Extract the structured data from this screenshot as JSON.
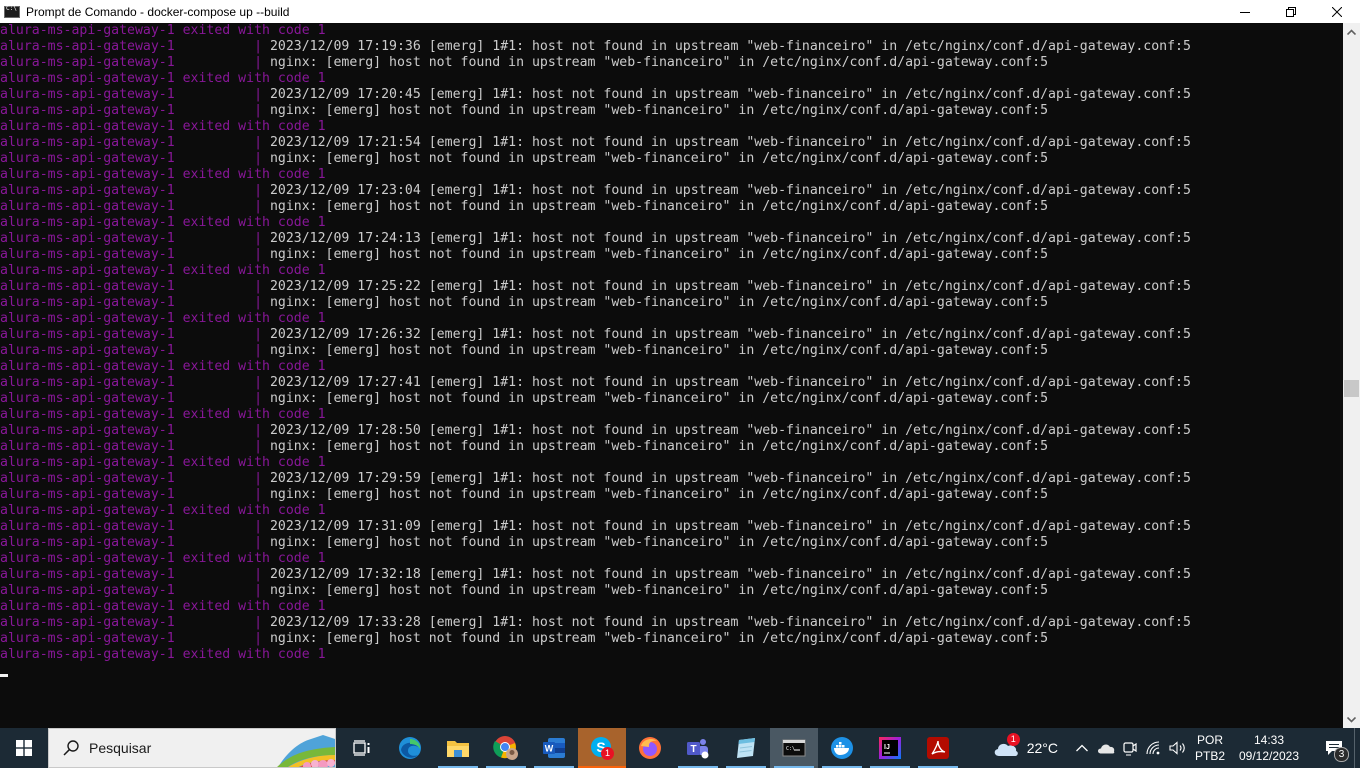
{
  "window": {
    "title": "Prompt de Comando - docker-compose  up --build",
    "controls": {
      "minimize": "minimize",
      "restore": "restore",
      "close": "close"
    }
  },
  "terminal": {
    "colors": {
      "service": "#881798",
      "message": "#cccccc",
      "background": "#0c0c0c"
    },
    "service_name": "alura-ms-api-gateway-1",
    "lines": [
      {
        "svc": "alura-ms-api-gateway-1 exited with code 1",
        "msg": ""
      },
      {
        "svc": "alura-ms-api-gateway-1          | ",
        "msg": "2023/12/09 17:19:36 [emerg] 1#1: host not found in upstream \"web-financeiro\" in /etc/nginx/conf.d/api-gateway.conf:5"
      },
      {
        "svc": "alura-ms-api-gateway-1          | ",
        "msg": "nginx: [emerg] host not found in upstream \"web-financeiro\" in /etc/nginx/conf.d/api-gateway.conf:5"
      },
      {
        "svc": "alura-ms-api-gateway-1 exited with code 1",
        "msg": ""
      },
      {
        "svc": "alura-ms-api-gateway-1          | ",
        "msg": "2023/12/09 17:20:45 [emerg] 1#1: host not found in upstream \"web-financeiro\" in /etc/nginx/conf.d/api-gateway.conf:5"
      },
      {
        "svc": "alura-ms-api-gateway-1          | ",
        "msg": "nginx: [emerg] host not found in upstream \"web-financeiro\" in /etc/nginx/conf.d/api-gateway.conf:5"
      },
      {
        "svc": "alura-ms-api-gateway-1 exited with code 1",
        "msg": ""
      },
      {
        "svc": "alura-ms-api-gateway-1          | ",
        "msg": "2023/12/09 17:21:54 [emerg] 1#1: host not found in upstream \"web-financeiro\" in /etc/nginx/conf.d/api-gateway.conf:5"
      },
      {
        "svc": "alura-ms-api-gateway-1          | ",
        "msg": "nginx: [emerg] host not found in upstream \"web-financeiro\" in /etc/nginx/conf.d/api-gateway.conf:5"
      },
      {
        "svc": "alura-ms-api-gateway-1 exited with code 1",
        "msg": ""
      },
      {
        "svc": "alura-ms-api-gateway-1          | ",
        "msg": "2023/12/09 17:23:04 [emerg] 1#1: host not found in upstream \"web-financeiro\" in /etc/nginx/conf.d/api-gateway.conf:5"
      },
      {
        "svc": "alura-ms-api-gateway-1          | ",
        "msg": "nginx: [emerg] host not found in upstream \"web-financeiro\" in /etc/nginx/conf.d/api-gateway.conf:5"
      },
      {
        "svc": "alura-ms-api-gateway-1 exited with code 1",
        "msg": ""
      },
      {
        "svc": "alura-ms-api-gateway-1          | ",
        "msg": "2023/12/09 17:24:13 [emerg] 1#1: host not found in upstream \"web-financeiro\" in /etc/nginx/conf.d/api-gateway.conf:5"
      },
      {
        "svc": "alura-ms-api-gateway-1          | ",
        "msg": "nginx: [emerg] host not found in upstream \"web-financeiro\" in /etc/nginx/conf.d/api-gateway.conf:5"
      },
      {
        "svc": "alura-ms-api-gateway-1 exited with code 1",
        "msg": ""
      },
      {
        "svc": "alura-ms-api-gateway-1          | ",
        "msg": "2023/12/09 17:25:22 [emerg] 1#1: host not found in upstream \"web-financeiro\" in /etc/nginx/conf.d/api-gateway.conf:5"
      },
      {
        "svc": "alura-ms-api-gateway-1          | ",
        "msg": "nginx: [emerg] host not found in upstream \"web-financeiro\" in /etc/nginx/conf.d/api-gateway.conf:5"
      },
      {
        "svc": "alura-ms-api-gateway-1 exited with code 1",
        "msg": ""
      },
      {
        "svc": "alura-ms-api-gateway-1          | ",
        "msg": "2023/12/09 17:26:32 [emerg] 1#1: host not found in upstream \"web-financeiro\" in /etc/nginx/conf.d/api-gateway.conf:5"
      },
      {
        "svc": "alura-ms-api-gateway-1          | ",
        "msg": "nginx: [emerg] host not found in upstream \"web-financeiro\" in /etc/nginx/conf.d/api-gateway.conf:5"
      },
      {
        "svc": "alura-ms-api-gateway-1 exited with code 1",
        "msg": ""
      },
      {
        "svc": "alura-ms-api-gateway-1          | ",
        "msg": "2023/12/09 17:27:41 [emerg] 1#1: host not found in upstream \"web-financeiro\" in /etc/nginx/conf.d/api-gateway.conf:5"
      },
      {
        "svc": "alura-ms-api-gateway-1          | ",
        "msg": "nginx: [emerg] host not found in upstream \"web-financeiro\" in /etc/nginx/conf.d/api-gateway.conf:5"
      },
      {
        "svc": "alura-ms-api-gateway-1 exited with code 1",
        "msg": ""
      },
      {
        "svc": "alura-ms-api-gateway-1          | ",
        "msg": "2023/12/09 17:28:50 [emerg] 1#1: host not found in upstream \"web-financeiro\" in /etc/nginx/conf.d/api-gateway.conf:5"
      },
      {
        "svc": "alura-ms-api-gateway-1          | ",
        "msg": "nginx: [emerg] host not found in upstream \"web-financeiro\" in /etc/nginx/conf.d/api-gateway.conf:5"
      },
      {
        "svc": "alura-ms-api-gateway-1 exited with code 1",
        "msg": ""
      },
      {
        "svc": "alura-ms-api-gateway-1          | ",
        "msg": "2023/12/09 17:29:59 [emerg] 1#1: host not found in upstream \"web-financeiro\" in /etc/nginx/conf.d/api-gateway.conf:5"
      },
      {
        "svc": "alura-ms-api-gateway-1          | ",
        "msg": "nginx: [emerg] host not found in upstream \"web-financeiro\" in /etc/nginx/conf.d/api-gateway.conf:5"
      },
      {
        "svc": "alura-ms-api-gateway-1 exited with code 1",
        "msg": ""
      },
      {
        "svc": "alura-ms-api-gateway-1          | ",
        "msg": "2023/12/09 17:31:09 [emerg] 1#1: host not found in upstream \"web-financeiro\" in /etc/nginx/conf.d/api-gateway.conf:5"
      },
      {
        "svc": "alura-ms-api-gateway-1          | ",
        "msg": "nginx: [emerg] host not found in upstream \"web-financeiro\" in /etc/nginx/conf.d/api-gateway.conf:5"
      },
      {
        "svc": "alura-ms-api-gateway-1 exited with code 1",
        "msg": ""
      },
      {
        "svc": "alura-ms-api-gateway-1          | ",
        "msg": "2023/12/09 17:32:18 [emerg] 1#1: host not found in upstream \"web-financeiro\" in /etc/nginx/conf.d/api-gateway.conf:5"
      },
      {
        "svc": "alura-ms-api-gateway-1          | ",
        "msg": "nginx: [emerg] host not found in upstream \"web-financeiro\" in /etc/nginx/conf.d/api-gateway.conf:5"
      },
      {
        "svc": "alura-ms-api-gateway-1 exited with code 1",
        "msg": ""
      },
      {
        "svc": "alura-ms-api-gateway-1          | ",
        "msg": "2023/12/09 17:33:28 [emerg] 1#1: host not found in upstream \"web-financeiro\" in /etc/nginx/conf.d/api-gateway.conf:5"
      },
      {
        "svc": "alura-ms-api-gateway-1          | ",
        "msg": "nginx: [emerg] host not found in upstream \"web-financeiro\" in /etc/nginx/conf.d/api-gateway.conf:5"
      },
      {
        "svc": "alura-ms-api-gateway-1 exited with code 1",
        "msg": ""
      }
    ],
    "scroll_position": 0.52
  },
  "taskbar": {
    "search_placeholder": "Pesquisar",
    "apps": [
      {
        "name": "task-view",
        "icon": "task-view-icon",
        "running": false
      },
      {
        "name": "edge",
        "icon": "edge-icon",
        "running": false
      },
      {
        "name": "file-explorer",
        "icon": "folder-icon",
        "running": true
      },
      {
        "name": "chrome",
        "icon": "chrome-icon",
        "running": true
      },
      {
        "name": "word",
        "icon": "word-icon",
        "running": true
      },
      {
        "name": "skype",
        "icon": "skype-icon",
        "running": true,
        "badge": "1",
        "flash": true
      },
      {
        "name": "firefox",
        "icon": "firefox-icon",
        "running": false
      },
      {
        "name": "teams",
        "icon": "teams-icon",
        "running": true
      },
      {
        "name": "notepad",
        "icon": "notepad-icon",
        "running": true
      },
      {
        "name": "command-prompt",
        "icon": "terminal-icon",
        "running": true,
        "active": true
      },
      {
        "name": "docker",
        "icon": "docker-icon",
        "running": true
      },
      {
        "name": "intellij",
        "icon": "intellij-icon",
        "running": true
      },
      {
        "name": "acrobat",
        "icon": "pdf-icon",
        "running": true
      }
    ],
    "tray": {
      "weather_badge": "1",
      "temperature": "22°C",
      "language_line1": "POR",
      "language_line2": "PTB2",
      "time": "14:33",
      "date": "09/12/2023",
      "notification_count": "3"
    }
  }
}
